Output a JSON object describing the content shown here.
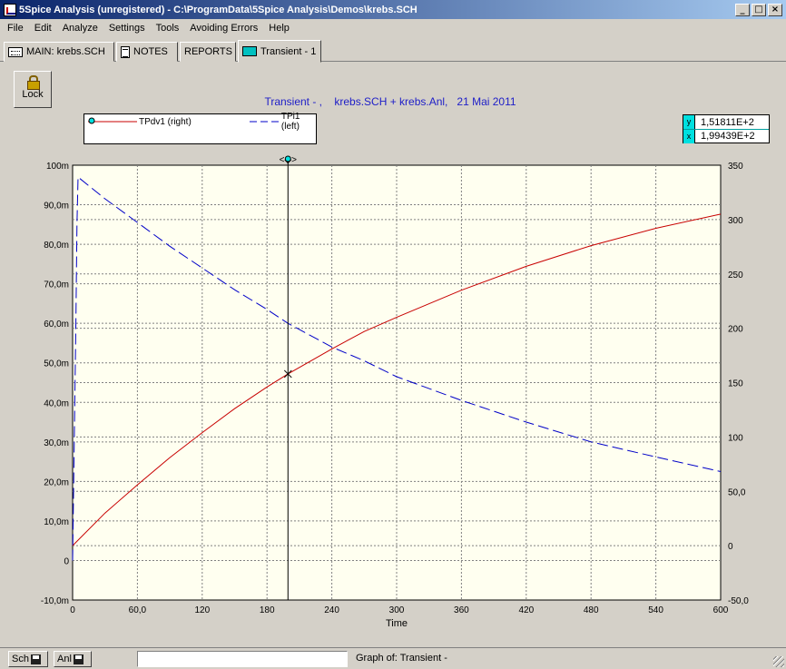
{
  "window": {
    "title": "5Spice Analysis (unregistered) - C:\\ProgramData\\5Spice Analysis\\Demos\\krebs.SCH",
    "controls": [
      "_",
      "□",
      "×"
    ]
  },
  "menu": [
    "File",
    "Edit",
    "Analyze",
    "Settings",
    "Tools",
    "Avoiding Errors",
    "Help"
  ],
  "tabs": [
    {
      "label": "MAIN:  krebs.SCH",
      "icon": "schematic-icon"
    },
    {
      "label": "NOTES",
      "icon": "notes-icon"
    },
    {
      "label": "REPORTS",
      "icon": ""
    },
    {
      "label": "Transient - 1",
      "icon": "transient-graph-icon"
    }
  ],
  "lock_button": {
    "label": "Lock",
    "icon": "lock-icon"
  },
  "cursor_readout": {
    "y_label": "y",
    "y_value": "1,51811E+2",
    "x_label": "x",
    "x_value": "1,99439E+2"
  },
  "cursor_marker": "<◆>",
  "chart_data": {
    "type": "line",
    "title": "Transient - ,    krebs.SCH + krebs.Anl,   21 Mai 2011",
    "xlabel": "Time",
    "ylabel": "",
    "xlim": [
      0,
      600
    ],
    "ylim_left": [
      -0.01,
      0.1
    ],
    "ylim_right": [
      -50,
      350
    ],
    "x_ticks": [
      "0",
      "60,0",
      "120",
      "180",
      "240",
      "300",
      "360",
      "420",
      "480",
      "540",
      "600"
    ],
    "y_left_ticks": [
      "100m",
      "90,0m",
      "80,0m",
      "70,0m",
      "60,0m",
      "50,0m",
      "40,0m",
      "30,0m",
      "20,0m",
      "10,0m",
      "0",
      "-10,0m"
    ],
    "y_right_ticks": [
      "350",
      "300",
      "250",
      "200",
      "150",
      "100",
      "50,0",
      "0",
      "-50,0"
    ],
    "grid": true,
    "legend_position": "top-left",
    "cursor_x": 199.4,
    "colors": {
      "TPdv1": "#c80000",
      "TPi1": "#0000c8"
    },
    "series": [
      {
        "name": "TPdv1 (right)",
        "axis": "right",
        "style": "solid",
        "x": [
          0,
          30,
          60,
          90,
          120,
          150,
          180,
          199.4,
          240,
          270,
          300,
          360,
          420,
          480,
          540,
          600
        ],
        "y": [
          0,
          30,
          56,
          81,
          104,
          126,
          146,
          158,
          181,
          197,
          210,
          235,
          257,
          276,
          292,
          305
        ]
      },
      {
        "name": "TPi1 (left)",
        "axis": "left",
        "style": "dashed",
        "x": [
          0,
          1,
          2,
          3,
          4,
          5,
          30,
          60,
          90,
          120,
          150,
          180,
          199.4,
          240,
          270,
          300,
          360,
          420,
          480,
          540,
          600
        ],
        "y": [
          0,
          0.02,
          0.04,
          0.06,
          0.085,
          0.097,
          0.0915,
          0.0855,
          0.0795,
          0.074,
          0.0685,
          0.0635,
          0.06,
          0.054,
          0.0505,
          0.0465,
          0.0405,
          0.035,
          0.03,
          0.0262,
          0.0225
        ]
      }
    ]
  },
  "status": {
    "sch_label": "Sch",
    "anl_label": "Anl",
    "field_value": "",
    "graph_of": "Graph of:  Transient -"
  }
}
